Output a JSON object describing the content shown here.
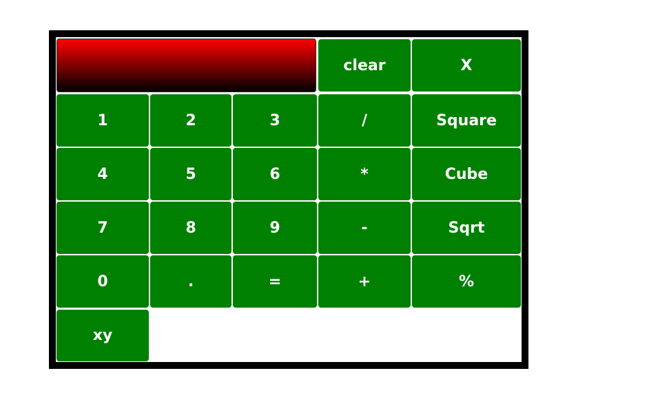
{
  "display": {
    "value": ""
  },
  "buttons": {
    "clear": "clear",
    "x": "X",
    "d1": "1",
    "d2": "2",
    "d3": "3",
    "divide": "/",
    "square": "Square",
    "d4": "4",
    "d5": "5",
    "d6": "6",
    "multiply": "*",
    "cube": "Cube",
    "d7": "7",
    "d8": "8",
    "d9": "9",
    "subtract": "-",
    "sqrt": "Sqrt",
    "d0": "0",
    "dot": ".",
    "equals": "=",
    "add": "+",
    "percent": "%",
    "power": "xy"
  },
  "colors": {
    "button_bg": "#008000",
    "display_top": "#ff0000",
    "display_bottom": "#000000",
    "frame": "#000000"
  }
}
